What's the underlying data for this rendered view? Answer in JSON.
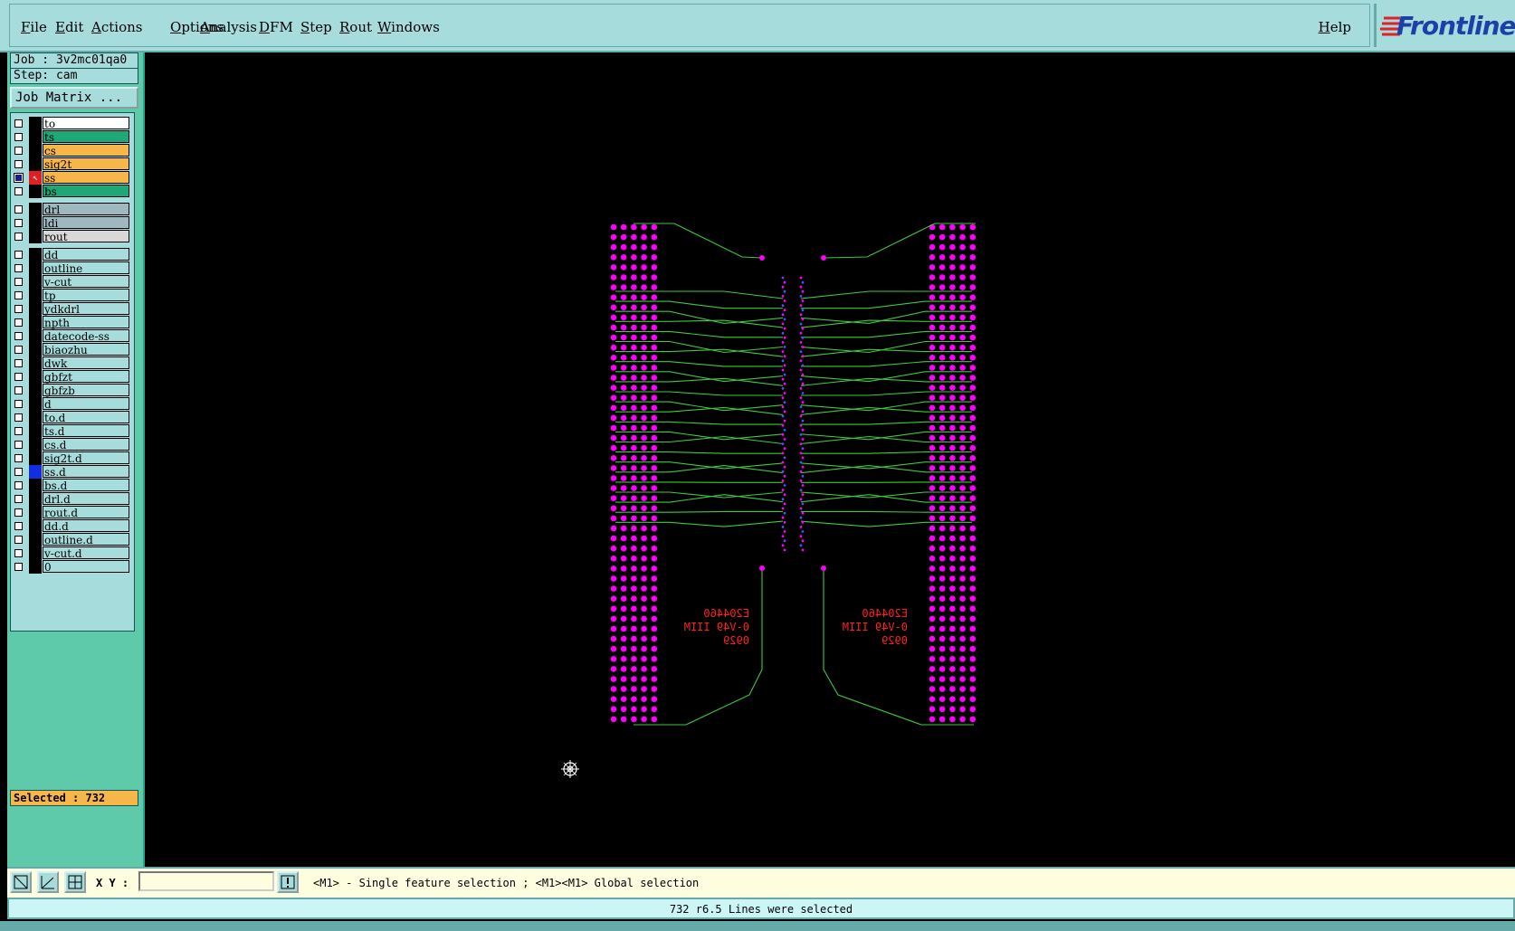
{
  "menu": {
    "items": [
      "File",
      "Edit",
      "Actions",
      "Options",
      "Analysis",
      "DFM",
      "Step",
      "Rout",
      "Windows"
    ],
    "help": "Help",
    "logo": "Frontline"
  },
  "job": {
    "job_line": "Job : 3v2mc01qa0",
    "step_line": "Step: cam",
    "matrix_button": "Job Matrix ..."
  },
  "layers": [
    {
      "name": "to",
      "color": "#ffffff",
      "checked": false
    },
    {
      "name": "ts",
      "color": "#1ea878",
      "checked": false
    },
    {
      "name": "cs",
      "color": "#f7b64a",
      "checked": false
    },
    {
      "name": "sig2t",
      "color": "#f7b64a",
      "checked": false
    },
    {
      "name": "ss",
      "color": "#f7b64a",
      "checked": true,
      "marked": true
    },
    {
      "name": "bs",
      "color": "#1ea878",
      "checked": false
    },
    {
      "name": "drl",
      "color": "#9fb8c0",
      "checked": false,
      "gap": true
    },
    {
      "name": "ldi",
      "color": "#9fb8c0",
      "checked": false
    },
    {
      "name": "rout",
      "color": "#d8d8d8",
      "checked": false
    },
    {
      "name": "dd",
      "color": "#a7dcdc",
      "checked": false,
      "gap": true
    },
    {
      "name": "outline",
      "color": "#a7dcdc",
      "checked": false
    },
    {
      "name": "v-cut",
      "color": "#a7dcdc",
      "checked": false
    },
    {
      "name": "tp",
      "color": "#a7dcdc",
      "checked": false
    },
    {
      "name": "ydkdrl",
      "color": "#a7dcdc",
      "checked": false
    },
    {
      "name": "npth",
      "color": "#a7dcdc",
      "checked": false
    },
    {
      "name": "datecode-ss",
      "color": "#a7dcdc",
      "checked": false
    },
    {
      "name": "biaozhu",
      "color": "#a7dcdc",
      "checked": false
    },
    {
      "name": "dwk",
      "color": "#a7dcdc",
      "checked": false
    },
    {
      "name": "gbfzt",
      "color": "#a7dcdc",
      "checked": false
    },
    {
      "name": "gbfzb",
      "color": "#a7dcdc",
      "checked": false
    },
    {
      "name": "d",
      "color": "#a7dcdc",
      "checked": false
    },
    {
      "name": "to.d",
      "color": "#a7dcdc",
      "checked": false
    },
    {
      "name": "ts.d",
      "color": "#a7dcdc",
      "checked": false
    },
    {
      "name": "cs.d",
      "color": "#a7dcdc",
      "checked": false
    },
    {
      "name": "sig2t.d",
      "color": "#a7dcdc",
      "checked": false
    },
    {
      "name": "ss.d",
      "color": "#a7dcdc",
      "checked": false,
      "blue": true
    },
    {
      "name": "bs.d",
      "color": "#a7dcdc",
      "checked": false
    },
    {
      "name": "drl.d",
      "color": "#a7dcdc",
      "checked": false
    },
    {
      "name": "rout.d",
      "color": "#a7dcdc",
      "checked": false
    },
    {
      "name": "dd.d",
      "color": "#a7dcdc",
      "checked": false
    },
    {
      "name": "outline.d",
      "color": "#a7dcdc",
      "checked": false
    },
    {
      "name": "v-cut.d",
      "color": "#a7dcdc",
      "checked": false
    },
    {
      "name": "0",
      "color": "#a7dcdc",
      "checked": false
    }
  ],
  "selected": "Selected : 732",
  "toolbar": {
    "xy_label": "X Y :",
    "xy_value": "",
    "hint": "<M1> - Single feature selection ; <M1><M1> Global selection"
  },
  "status": "732 r6.5 Lines were selected",
  "board": {
    "marking_lines": [
      "E204460",
      "0-V49 IIIM",
      "0929"
    ],
    "colors": {
      "pad": "#ff00ff",
      "trace": "#3ec83e",
      "text": "#ff2020",
      "via": "#5050ff"
    }
  }
}
